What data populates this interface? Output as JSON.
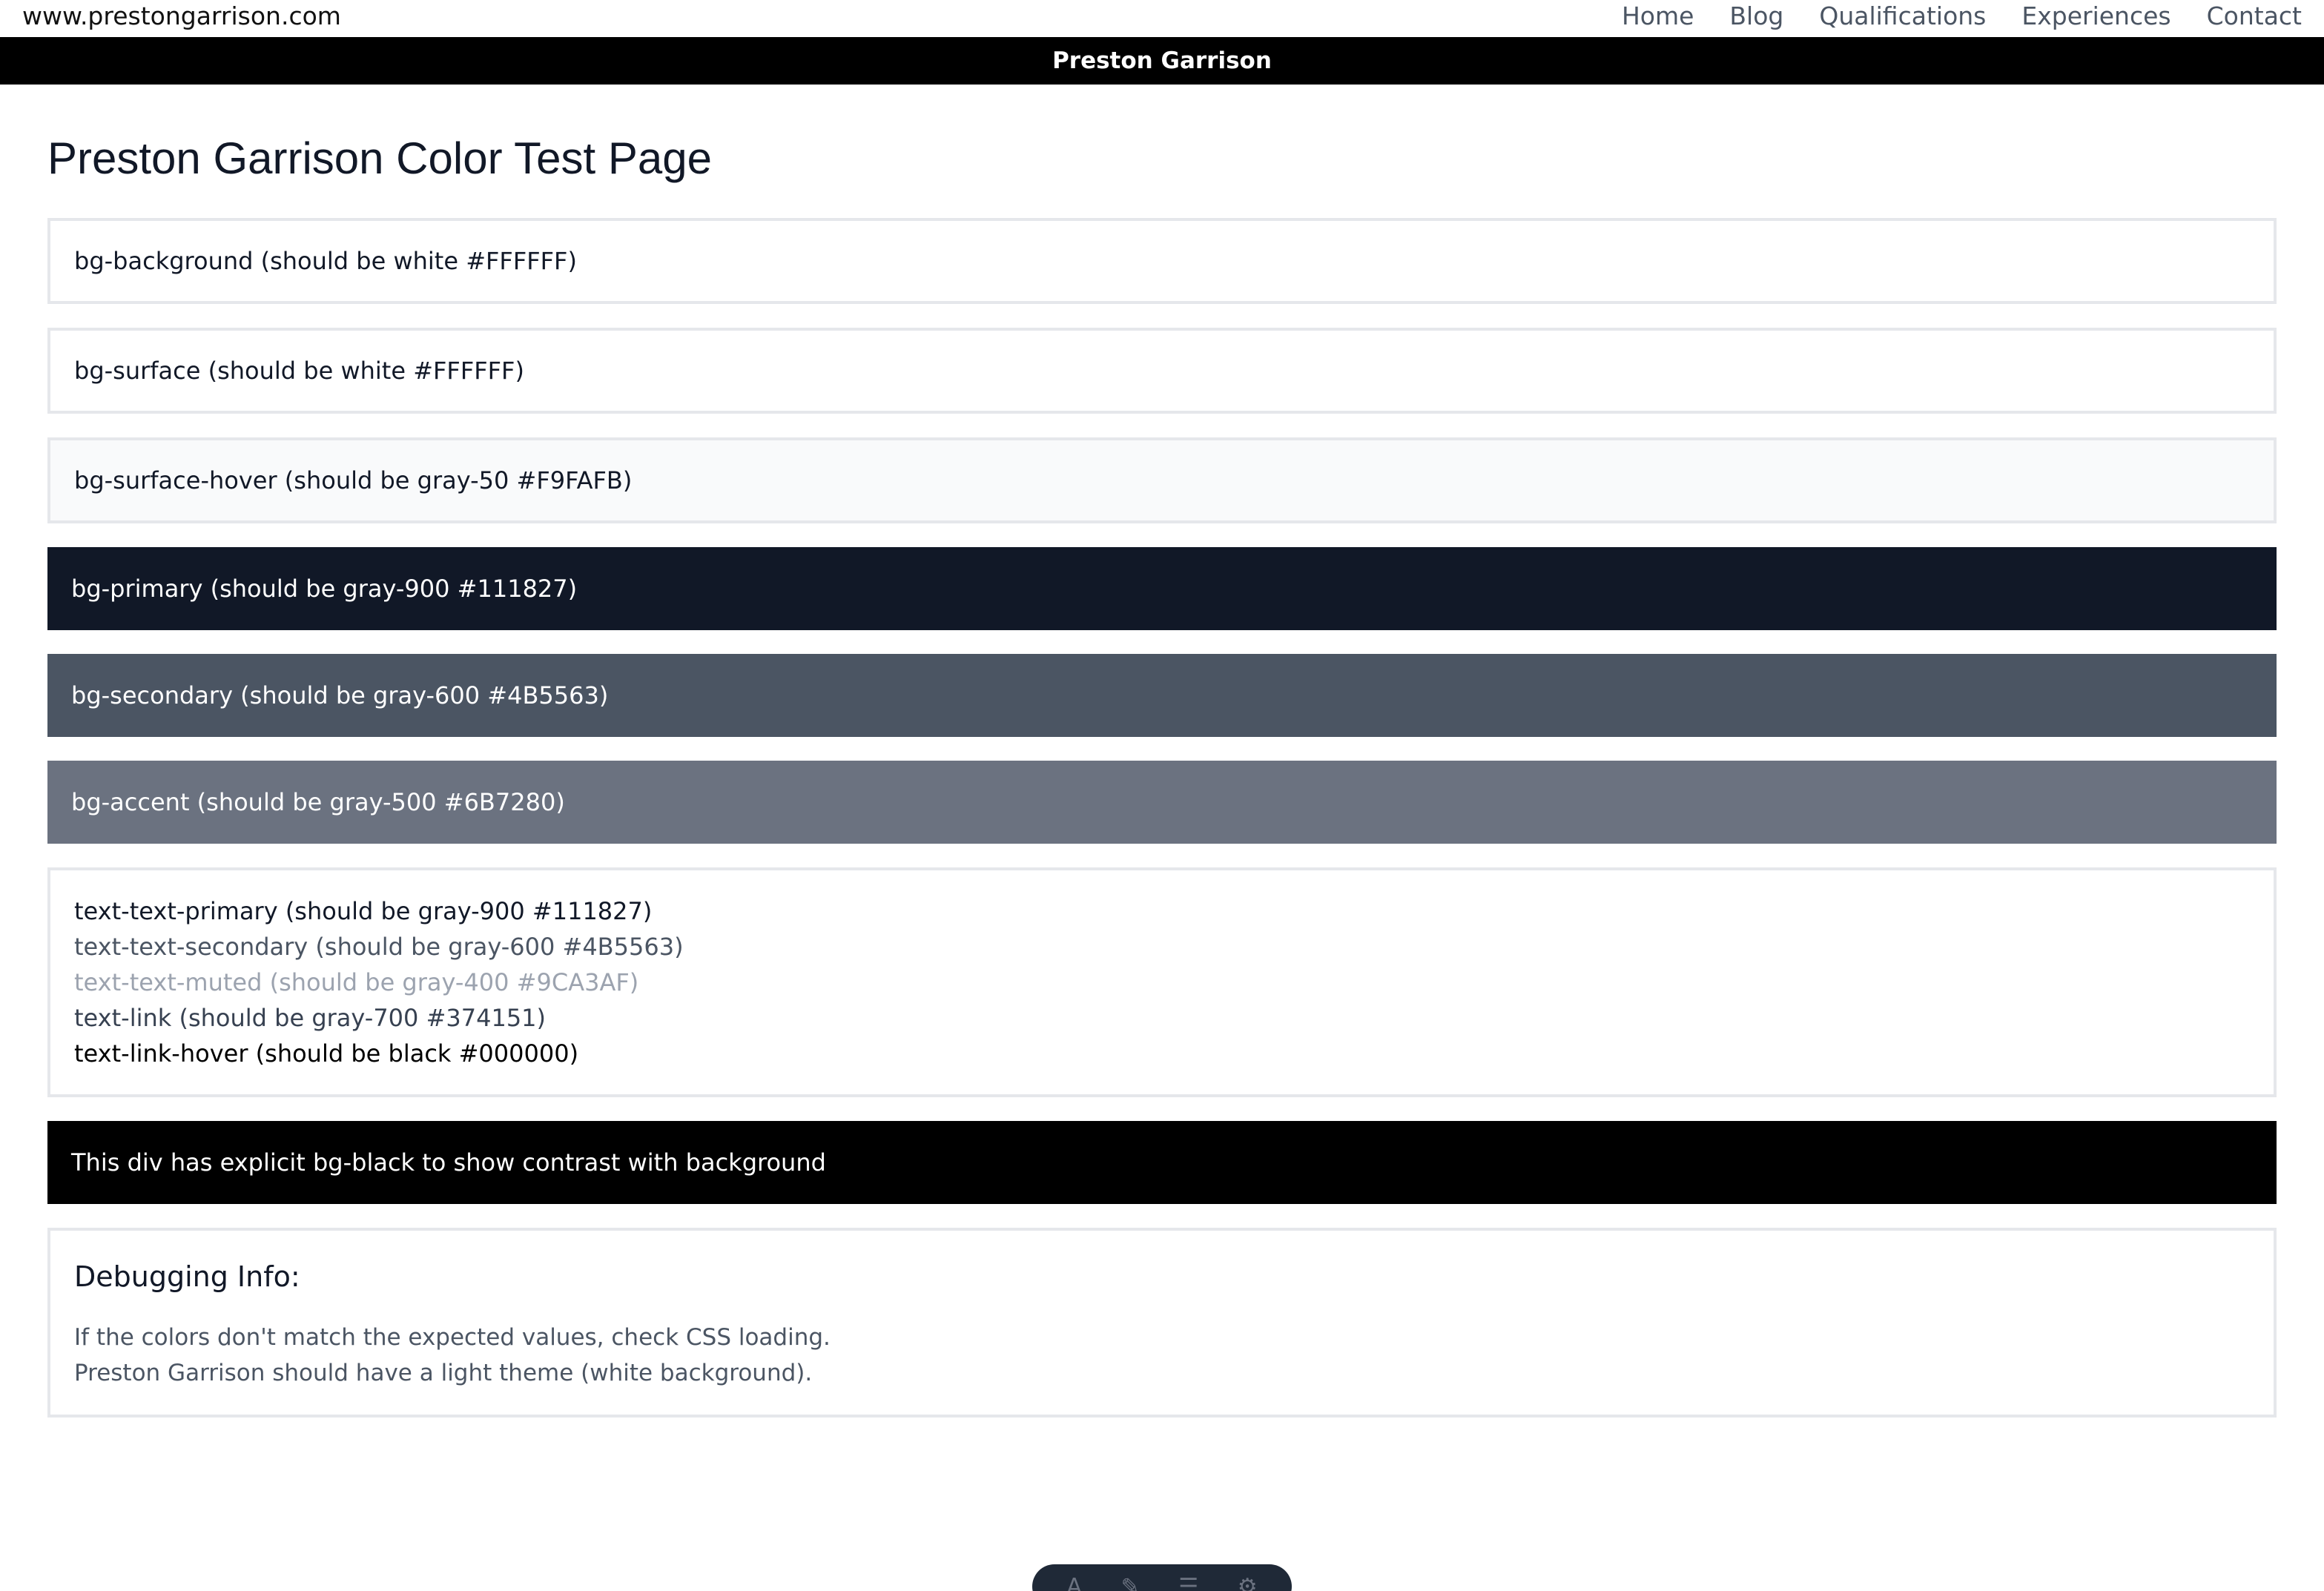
{
  "header": {
    "site_url": "www.prestongarrison.com",
    "nav": [
      "Home",
      "Blog",
      "Qualifications",
      "Experiences",
      "Contact"
    ]
  },
  "brand_bar": {
    "title": "Preston Garrison"
  },
  "main": {
    "heading": "Preston Garrison Color Test Page",
    "swatches": [
      {
        "label": "bg-background (should be white #FFFFFF)",
        "bg": "#FFFFFF",
        "color": "#111827"
      },
      {
        "label": "bg-surface (should be white #FFFFFF)",
        "bg": "#FFFFFF",
        "color": "#111827"
      },
      {
        "label": "bg-surface-hover (should be gray-50 #F9FAFB)",
        "bg": "#F9FAFB",
        "color": "#111827"
      },
      {
        "label": "bg-primary (should be gray-900 #111827)",
        "bg": "#111827",
        "color": "#FFFFFF"
      },
      {
        "label": "bg-secondary (should be gray-600 #4B5563)",
        "bg": "#4B5563",
        "color": "#FFFFFF"
      },
      {
        "label": "bg-accent (should be gray-500 #6B7280)",
        "bg": "#6B7280",
        "color": "#FFFFFF"
      }
    ],
    "text_samples": [
      {
        "label": "text-text-primary (should be gray-900 #111827)",
        "color": "#111827"
      },
      {
        "label": "text-text-secondary (should be gray-600 #4B5563)",
        "color": "#4B5563"
      },
      {
        "label": "text-text-muted (should be gray-400 #9CA3AF)",
        "color": "#9CA3AF"
      },
      {
        "label": "text-link (should be gray-700 #374151)",
        "color": "#374151"
      },
      {
        "label": "text-link-hover (should be black #000000)",
        "color": "#000000"
      }
    ],
    "black_box": "This div has explicit bg-black to show contrast with background",
    "debug": {
      "title": "Debugging Info:",
      "line1": "If the colors don't match the expected values, check CSS loading.",
      "line2": "Preston Garrison should have a light theme (white background)."
    }
  },
  "toolbar": {
    "icons": [
      "text-icon",
      "brush-icon",
      "menu-icon",
      "settings-icon"
    ]
  }
}
